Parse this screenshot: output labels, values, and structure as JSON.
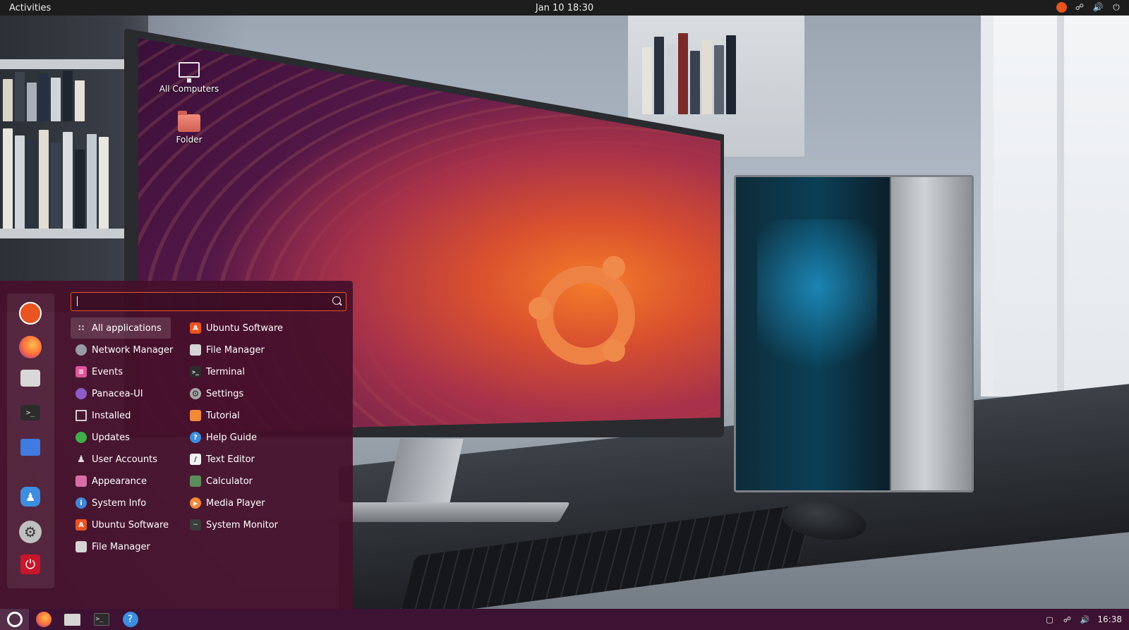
{
  "topbar": {
    "activities": "Activities",
    "clock": "Jan 10  18:30",
    "tray_icons": [
      "ubuntu-icon",
      "network-icon",
      "volume-icon",
      "power-icon"
    ]
  },
  "desktop": {
    "icons": [
      {
        "label": "All Computers",
        "icon": "monitor-icon"
      },
      {
        "label": "Folder",
        "icon": "folder-icon"
      }
    ]
  },
  "menu": {
    "search": {
      "value": "",
      "placeholder": ""
    },
    "sidebar": [
      "ubuntu-icon",
      "firefox-icon",
      "files-icon",
      "terminal-icon",
      "folder-icon",
      "help-icon",
      "settings-icon",
      "power-icon"
    ],
    "left_column": [
      {
        "label": "All applications",
        "icon": "grid-icon",
        "color": "#cccccc",
        "active": true
      },
      {
        "label": "Network Manager",
        "icon": "globe-icon",
        "color": "#9a9aa6"
      },
      {
        "label": "Events",
        "icon": "calendar-icon",
        "color": "#e0559a"
      },
      {
        "label": "Panacea-UI",
        "icon": "panacea-icon",
        "color": "#8c5cc8"
      },
      {
        "label": "Installed",
        "icon": "monitor-icon",
        "color": "#d0d0d0"
      },
      {
        "label": "Updates",
        "icon": "updates-icon",
        "color": "#3fae49"
      },
      {
        "label": "User Accounts",
        "icon": "users-icon",
        "color": "#b8b8c0"
      },
      {
        "label": "Appearance",
        "icon": "appearance-icon",
        "color": "#d86ea8"
      },
      {
        "label": "System Info",
        "icon": "info-icon",
        "color": "#3f87d9"
      },
      {
        "label": "Ubuntu Software",
        "icon": "software-icon",
        "color": "#e95420"
      },
      {
        "label": "File Manager",
        "icon": "files-icon",
        "color": "#d5d5d5"
      }
    ],
    "right_column": [
      {
        "label": "Ubuntu Software",
        "icon": "software-icon",
        "color": "#e95420"
      },
      {
        "label": "File Manager",
        "icon": "files-icon",
        "color": "#d5d5d5"
      },
      {
        "label": "Terminal",
        "icon": "terminal-icon",
        "color": "#2c2c2c"
      },
      {
        "label": "Settings",
        "icon": "settings-icon",
        "color": "#a8a8a8"
      },
      {
        "label": "Tutorial",
        "icon": "tutorial-icon",
        "color": "#f08a3a"
      },
      {
        "label": "Help Guide",
        "icon": "help-icon",
        "color": "#3d8de0"
      },
      {
        "label": "Text Editor",
        "icon": "text-editor-icon",
        "color": "#f2f2f2"
      },
      {
        "label": "Calculator",
        "icon": "calculator-icon",
        "color": "#5c8c5c"
      },
      {
        "label": "Media Player",
        "icon": "media-player-icon",
        "color": "#f08a3a"
      },
      {
        "label": "System Monitor",
        "icon": "system-monitor-icon",
        "color": "#3c3c3c"
      }
    ]
  },
  "taskbar": {
    "apps": [
      "ubuntu-icon",
      "firefox-icon",
      "files-icon",
      "terminal-icon",
      "help-icon"
    ],
    "clock": "16:38",
    "tray_icons": [
      "display-icon",
      "network-icon",
      "volume-icon"
    ]
  },
  "colors": {
    "accent": "#e95420",
    "menu_bg": "#46102c",
    "taskbar_bg": "#3d1232",
    "topbar_bg": "#1d1d1d"
  }
}
